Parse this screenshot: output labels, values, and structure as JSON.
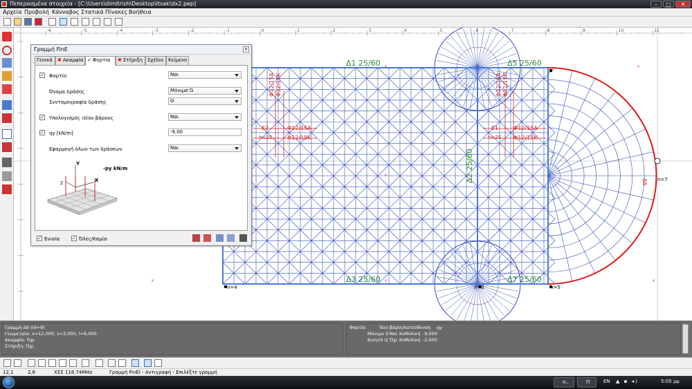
{
  "window": {
    "title": "Πεπερασμένα στοιχεία - [C:\\Users\\dimitrish\\Desktop\\ltsak\\dx2.pep]",
    "min": "–",
    "max": "□",
    "close": "✕"
  },
  "menu": [
    "Αρχεία",
    "Προβολή",
    "Κάνναβος",
    "Στατικά",
    "Πίνακες",
    "Βοήθεια"
  ],
  "canvas": {
    "ruler_ticks": [
      "-6",
      "-5",
      "-4",
      "-3",
      "-2",
      "-1",
      "0",
      "1",
      "2",
      "3",
      "4",
      "5",
      "6",
      "7",
      "8",
      "9",
      "10",
      "11"
    ],
    "beams": {
      "d1": "Δ1 25/60",
      "d5": "Δ5 25/60",
      "d3": "Δ3 25/60",
      "d7": "Δ7 25/60",
      "d2": "Δ2 25/60",
      "d6": "Δ6"
    },
    "slab_e2": {
      "name": "E2",
      "h": "h=25",
      "rebar": [
        "Φ12/15A",
        "Φ12/15K",
        "Φ12/15A",
        "Φ12/15K"
      ]
    },
    "slab_e1": {
      "name": "E1",
      "h": "h=25",
      "rebar": [
        "Φ12/15A",
        "Φ12/15K",
        "Φ12/15A",
        "Φ12/15K"
      ]
    },
    "nodes": [
      "n=4",
      "n=3",
      "n=5",
      "n=7"
    ],
    "colors": {
      "mesh": "#2f4fb5",
      "beam": "#4a78d8",
      "arc": "#e01818",
      "rebar": "#d62020",
      "beam_label": "#2e8b2e"
    }
  },
  "dialog": {
    "title": "Γραμμή FinE",
    "close": "×",
    "tabs": [
      {
        "label": "Γενικά",
        "mark": ""
      },
      {
        "label": "Ακαμψία",
        "mark": "x"
      },
      {
        "label": "Φορτία",
        "mark": "v"
      },
      {
        "label": "Στήριξη",
        "mark": "x"
      },
      {
        "label": "Σχέδιο",
        "mark": ""
      },
      {
        "label": "Κείμενο",
        "mark": ""
      }
    ],
    "rows": {
      "load": {
        "label": "Φορτίο",
        "value": "Ναι",
        "checked": true
      },
      "action_name": {
        "label": "Όνομα δράσης",
        "value": "Μόνιμα G"
      },
      "action_abbr": {
        "label": "Συντομογραφία δράσης",
        "value": "G"
      },
      "self_weight": {
        "label": "Υπολογισμός ιδίου βάρους",
        "value": "Ναι",
        "checked": true
      },
      "qy": {
        "label": "qy [kN/m]",
        "value": "-9,00",
        "checked": true
      },
      "apply_all": {
        "label": "Εφαρμογή όλων των δράσεων",
        "value": "Ναι"
      }
    },
    "figure": {
      "y": "Y",
      "z": "Z",
      "x": "X",
      "load": "-py kN/m"
    },
    "footer": {
      "unified": "Ενιαία",
      "all_none": "Όλες/Καμία"
    }
  },
  "info_left": {
    "line1": "Γραμμή Δ6            (id=9)",
    "line2": "Γεωμετρία: x=12,000, z=3,000, l=6,000",
    "line3": "Ακαμψία: Όχι",
    "line4": "Στήριξη: Όχι"
  },
  "info_right": {
    "header": [
      "Φορτίο",
      "Ίδιο βάρος",
      "Κατεύθυνση",
      "qy"
    ],
    "rows": [
      [
        "Μόνιμα G",
        "Ναι",
        "Καθολική",
        "-9,000"
      ],
      [
        "Κινητά Q",
        "Όχι",
        "Καθολική",
        "-2,000"
      ]
    ]
  },
  "status": {
    "x": "12,1",
    "y": "2,6",
    "grid": "ΧΣΣ 118.74MHz",
    "msg": "Γραμμή FinEl - Αντιγραφή - Επιλέξτε γραμμή"
  },
  "taskbar": {
    "item1": "n..",
    "item2": "Π",
    "lang": "EN",
    "time": "5:05 μμ"
  }
}
